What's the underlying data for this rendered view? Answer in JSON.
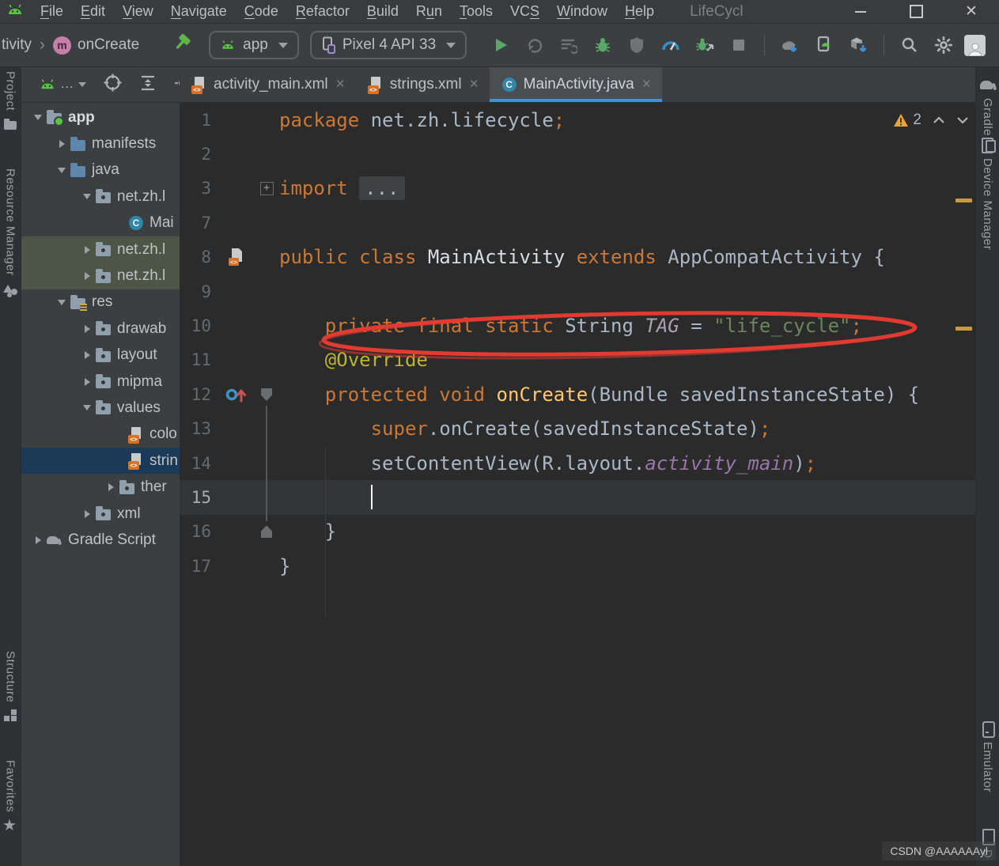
{
  "app": {
    "accent_blue": "#3C93D6",
    "annotation_red": "#E23B32",
    "keyword_orange": "#CC7832",
    "string_green": "#6A8759"
  },
  "menu": {
    "items": [
      {
        "pre": "",
        "mn": "F",
        "post": "ile"
      },
      {
        "pre": "",
        "mn": "E",
        "post": "dit"
      },
      {
        "pre": "",
        "mn": "V",
        "post": "iew"
      },
      {
        "pre": "",
        "mn": "N",
        "post": "avigate"
      },
      {
        "pre": "",
        "mn": "C",
        "post": "ode"
      },
      {
        "pre": "",
        "mn": "R",
        "post": "efactor"
      },
      {
        "pre": "",
        "mn": "B",
        "post": "uild"
      },
      {
        "pre": "R",
        "mn": "u",
        "post": "n"
      },
      {
        "pre": "",
        "mn": "T",
        "post": "ools"
      },
      {
        "pre": "VC",
        "mn": "S",
        "post": ""
      },
      {
        "pre": "",
        "mn": "W",
        "post": "indow"
      },
      {
        "pre": "",
        "mn": "H",
        "post": "elp"
      }
    ],
    "window_title": "LifeCycl",
    "window_controls": [
      "minimize-icon",
      "maximize-icon",
      "close-icon"
    ]
  },
  "toolbar": {
    "breadcrumb": {
      "prefix": "tivity",
      "separator": "›",
      "method_badge": "m",
      "method": "onCreate"
    },
    "run_config": "app",
    "device": "Pixel 4 API 33",
    "icons": [
      "build-hammer",
      "run",
      "apply-changes",
      "apply-code-changes",
      "debug",
      "attach-profiler",
      "profiler",
      "attach-debugger",
      "stop",
      "sync-gradle",
      "device-manager",
      "sdk-manager",
      "search-everywhere",
      "settings",
      "avatar"
    ]
  },
  "project_header": {
    "icons": [
      "android-view-selector",
      "dots",
      "locate-file",
      "collapse-all",
      "settings-partial"
    ],
    "dots": "..."
  },
  "tabs": [
    {
      "label": "activity_main.xml",
      "close": "×",
      "icon": "xml-file",
      "cls": ""
    },
    {
      "label": "strings.xml",
      "close": "×",
      "icon": "xml-file",
      "cls": ""
    },
    {
      "label": "MainActivity.java",
      "close": "×",
      "icon": "java-class",
      "cls": "active"
    }
  ],
  "project_tree": {
    "rows": [
      {
        "label": "app",
        "chev": "expanded",
        "icon": "folder folder-app",
        "row": "ind-a",
        "lcls": "bold"
      },
      {
        "label": "manifests",
        "chev": "collapsed",
        "icon": "folder folder-blue",
        "row": "ind-b",
        "lcls": ""
      },
      {
        "label": "java",
        "chev": "expanded",
        "icon": "folder folder-blue",
        "row": "ind-b",
        "lcls": ""
      },
      {
        "label": "net.zh.l",
        "chev": "expanded",
        "icon": "folder folder-pkg",
        "row": "ind-c",
        "lcls": ""
      },
      {
        "label": "Mai",
        "chev": "none",
        "icon": "class-badge",
        "row": "ind-e",
        "lcls": ""
      },
      {
        "label": "net.zh.l",
        "chev": "collapsed",
        "icon": "folder folder-pkg",
        "row": "ind-c hl-green",
        "lcls": ""
      },
      {
        "label": "net.zh.l",
        "chev": "collapsed",
        "icon": "folder folder-pkg",
        "row": "ind-c hl-green",
        "lcls": ""
      },
      {
        "label": "res",
        "chev": "expanded",
        "icon": "folder folder-res",
        "row": "ind-b",
        "lcls": ""
      },
      {
        "label": "drawab",
        "chev": "collapsed",
        "icon": "folder folder-pkg",
        "row": "ind-c",
        "lcls": ""
      },
      {
        "label": "layout",
        "chev": "collapsed",
        "icon": "folder folder-pkg",
        "row": "ind-c",
        "lcls": ""
      },
      {
        "label": "mipma",
        "chev": "collapsed",
        "icon": "folder folder-pkg",
        "row": "ind-c",
        "lcls": ""
      },
      {
        "label": "values",
        "chev": "expanded",
        "icon": "folder folder-pkg",
        "row": "ind-c",
        "lcls": ""
      },
      {
        "label": "colo",
        "chev": "none",
        "icon": "xml-file",
        "row": "ind-e",
        "lcls": ""
      },
      {
        "label": "strin",
        "chev": "none",
        "icon": "xml-file",
        "row": "ind-e selected",
        "lcls": ""
      },
      {
        "label": "ther",
        "chev": "collapsed",
        "icon": "folder folder-pkg",
        "row": "ind-d",
        "lcls": ""
      },
      {
        "label": "xml",
        "chev": "collapsed",
        "icon": "folder folder-pkg",
        "row": "ind-c",
        "lcls": ""
      },
      {
        "label": "Gradle Script",
        "chev": "collapsed",
        "icon": "gradle-ele",
        "row": "ind-a",
        "lcls": ""
      }
    ]
  },
  "editor": {
    "warning_count": "2",
    "annotation": {
      "shape": "ellipse",
      "color": "#E23B32",
      "target": "line 10"
    },
    "lines": [
      {
        "num": "1",
        "gicon": "",
        "fold": "",
        "row": "",
        "segs": [
          {
            "t": "package ",
            "c": "kw"
          },
          {
            "t": "net.zh.lifecycle",
            "c": "txt"
          },
          {
            "t": ";",
            "c": "kw"
          }
        ]
      },
      {
        "num": "2",
        "gicon": "",
        "fold": "",
        "row": "",
        "segs": []
      },
      {
        "num": "3",
        "gicon": "",
        "fold": "fold-plus",
        "row": "",
        "segs": [
          {
            "t": "import ",
            "c": "kw"
          },
          {
            "t": "...",
            "c": "folded"
          }
        ]
      },
      {
        "num": "7",
        "gicon": "",
        "fold": "",
        "row": "",
        "segs": []
      },
      {
        "num": "8",
        "gicon": "layout-file",
        "fold": "",
        "row": "",
        "segs": [
          {
            "t": "public class ",
            "c": "kw"
          },
          {
            "t": "MainActivity ",
            "c": "cls"
          },
          {
            "t": "extends ",
            "c": "kw"
          },
          {
            "t": "AppCompatActivity {",
            "c": "txt"
          }
        ]
      },
      {
        "num": "9",
        "gicon": "",
        "fold": "",
        "row": "",
        "segs": []
      },
      {
        "num": "10",
        "gicon": "",
        "fold": "",
        "row": "",
        "segs": [
          {
            "t": "    ",
            "c": "txt"
          },
          {
            "t": "private final static ",
            "c": "kw"
          },
          {
            "t": "String ",
            "c": "txt"
          },
          {
            "t": "TAG ",
            "c": "tagfld"
          },
          {
            "t": "= ",
            "c": "txt"
          },
          {
            "t": "\"life_cycle\"",
            "c": "str"
          },
          {
            "t": ";",
            "c": "kw"
          }
        ]
      },
      {
        "num": "11",
        "gicon": "",
        "fold": "",
        "row": "",
        "segs": [
          {
            "t": "    ",
            "c": "txt"
          },
          {
            "t": "@Override",
            "c": "ann"
          }
        ]
      },
      {
        "num": "12",
        "gicon": "override-marker",
        "fold": "fold-open",
        "row": "",
        "segs": [
          {
            "t": "    ",
            "c": "txt"
          },
          {
            "t": "protected void ",
            "c": "kw"
          },
          {
            "t": "onCreate",
            "c": "mth"
          },
          {
            "t": "(Bundle savedInstanceState) {",
            "c": "txt"
          }
        ]
      },
      {
        "num": "13",
        "gicon": "",
        "fold": "",
        "row": "",
        "segs": [
          {
            "t": "        ",
            "c": "txt"
          },
          {
            "t": "super",
            "c": "kw"
          },
          {
            "t": ".onCreate(savedInstanceState)",
            "c": "txt"
          },
          {
            "t": ";",
            "c": "kw"
          }
        ]
      },
      {
        "num": "14",
        "gicon": "",
        "fold": "",
        "row": "",
        "segs": [
          {
            "t": "        ",
            "c": "txt"
          },
          {
            "t": "setContentView(R.layout.",
            "c": "txt"
          },
          {
            "t": "activity_main",
            "c": "fld"
          },
          {
            "t": ")",
            "c": "txt"
          },
          {
            "t": ";",
            "c": "kw"
          }
        ]
      },
      {
        "num": "15",
        "gicon": "",
        "fold": "",
        "row": "current",
        "segs": []
      },
      {
        "num": "16",
        "gicon": "",
        "fold": "fold-end",
        "row": "",
        "segs": [
          {
            "t": "    }",
            "c": "txt"
          }
        ]
      },
      {
        "num": "17",
        "gicon": "",
        "fold": "",
        "row": "",
        "segs": [
          {
            "t": "}",
            "c": "txt"
          }
        ]
      }
    ]
  },
  "stripes": {
    "left": [
      {
        "label": "Project",
        "icon": "project-icon",
        "cls": "pos-project"
      },
      {
        "label": "Resource Manager",
        "icon": "resource-icon",
        "cls": "pos-resource"
      },
      {
        "label": "Structure",
        "icon": "structure-icon",
        "cls": "pos-structure"
      },
      {
        "label": "Favorites",
        "icon": "favorites-icon",
        "cls": "pos-favorites"
      }
    ],
    "right": [
      {
        "label": "Gradle",
        "icon": "gradle-icon",
        "cls": "pos-gradle",
        "order": "icon-first"
      },
      {
        "label": "Device Manager",
        "icon": "device-icon",
        "cls": "pos-devmgr",
        "order": "icon-first"
      },
      {
        "label": "Emulator",
        "icon": "emulator-icon",
        "cls": "pos-emulator",
        "order": "icon-first"
      },
      {
        "label": "D",
        "icon": "device-partial",
        "cls": "pos-partial",
        "order": "icon-first"
      }
    ]
  },
  "watermark": "CSDN @AAAAAAyl"
}
